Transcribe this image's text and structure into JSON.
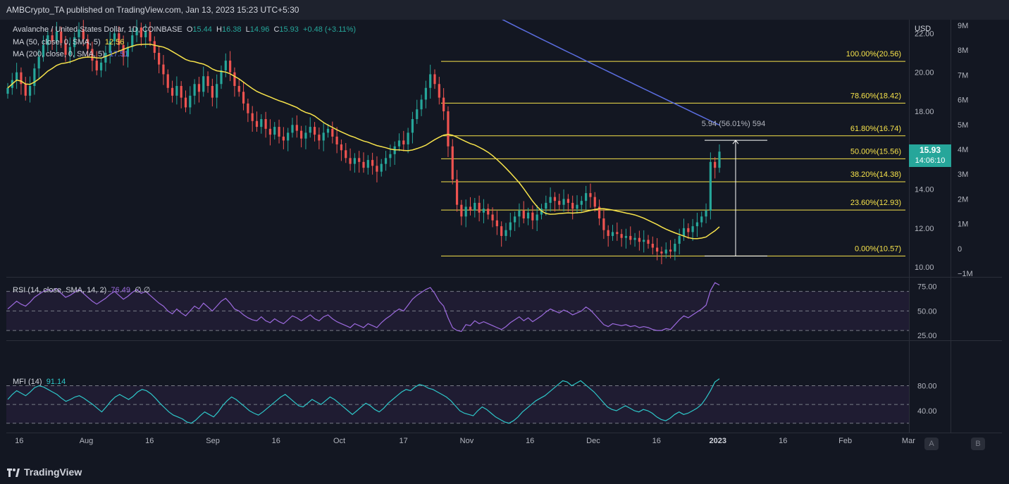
{
  "header": {
    "published_text": "AMBCrypto_TA published on TradingView.com, Jan 13, 2023 15:23 UTC+5:30"
  },
  "legend": {
    "symbol": "Avalanche / United States Dollar, 1D, COINBASE",
    "o_label": "O",
    "o_value": "15.44",
    "h_label": "H",
    "h_value": "16.38",
    "l_label": "L",
    "l_value": "14.96",
    "c_label": "C",
    "c_value": "15.93",
    "change": "+0.48 (+3.11%)",
    "ma50_label": "MA (50, close, 0, SMA, 5)",
    "ma50_value": "12.56",
    "ma200_label": "MA (200, close, 0, SMA, 5)",
    "ma200_value": "17.51",
    "rsi_label": "RSI (14, close, SMA, 14, 2)",
    "rsi_value": "76.49",
    "rsi_extra": "∅ ∅",
    "mfi_label": "MFI (14)",
    "mfi_value": "91.14"
  },
  "price_tag": {
    "price": "15.93",
    "countdown": "14:06:10"
  },
  "currency_label": "USD",
  "measure_label": "5.94 (56.01%) 594",
  "scale_buttons": {
    "a": "A",
    "b": "B"
  },
  "footer": {
    "brand": "TradingView"
  },
  "colors": {
    "up": "#26a69a",
    "down": "#ef5350",
    "ma50": "#f7e34b",
    "ma200": "#5b6ee1",
    "fib": "#f7e34b",
    "rsi": "#9c6ade",
    "mfi": "#2ec7c9",
    "band": "#2a2040"
  },
  "chart_data": {
    "type": "candlestick",
    "title": "Avalanche / United States Dollar, 1D, COINBASE",
    "x_ticks": [
      "16",
      "Aug",
      "16",
      "Sep",
      "16",
      "Oct",
      "17",
      "Nov",
      "16",
      "Dec",
      "16",
      "2023",
      "16",
      "Feb",
      "Mar"
    ],
    "price_ticks": [
      "22.00",
      "20.00",
      "18.00",
      "16.00",
      "14.00",
      "12.00",
      "10.00"
    ],
    "volume_ticks": [
      "9M",
      "8M",
      "7M",
      "6M",
      "5M",
      "4M",
      "3M",
      "2M",
      "1M",
      "0",
      "−1M"
    ],
    "ylim": [
      9.5,
      22.7
    ],
    "fib_levels": [
      {
        "label": "100.00%(20.56)",
        "value": 20.56
      },
      {
        "label": "78.60%(18.42)",
        "value": 18.42
      },
      {
        "label": "61.80%(16.74)",
        "value": 16.74
      },
      {
        "label": "50.00%(15.56)",
        "value": 15.56
      },
      {
        "label": "38.20%(14.38)",
        "value": 14.38
      },
      {
        "label": "23.60%(12.93)",
        "value": 12.93
      },
      {
        "label": "0.00%(10.57)",
        "value": 10.57
      }
    ],
    "closes": [
      19.2,
      19.6,
      20.0,
      19.4,
      18.8,
      19.3,
      20.2,
      20.8,
      21.4,
      21.9,
      21.6,
      22.1,
      21.5,
      20.9,
      21.3,
      21.8,
      22.2,
      21.7,
      21.2,
      20.6,
      20.1,
      20.5,
      21.0,
      21.6,
      22.0,
      21.4,
      20.8,
      21.3,
      21.9,
      22.3,
      21.8,
      22.1,
      21.6,
      21.0,
      20.4,
      19.9,
      19.2,
      18.8,
      19.3,
      18.7,
      18.2,
      18.8,
      19.4,
      19.0,
      19.8,
      19.3,
      18.7,
      19.4,
      20.1,
      20.6,
      20.0,
      19.3,
      19.0,
      18.4,
      17.9,
      17.5,
      17.2,
      17.6,
      17.1,
      16.8,
      17.2,
      16.7,
      16.5,
      16.9,
      17.3,
      17.0,
      16.6,
      16.9,
      17.2,
      16.8,
      16.5,
      16.9,
      17.1,
      16.7,
      16.3,
      16.0,
      15.6,
      15.3,
      15.6,
      15.4,
      15.1,
      15.5,
      15.2,
      14.9,
      15.3,
      15.6,
      15.8,
      16.2,
      16.5,
      16.3,
      16.9,
      17.6,
      18.1,
      18.6,
      19.2,
      19.9,
      19.4,
      18.7,
      18.0,
      16.2,
      14.5,
      13.2,
      12.6,
      13.1,
      12.9,
      13.3,
      12.8,
      13.0,
      12.7,
      12.4,
      12.1,
      11.6,
      11.9,
      12.3,
      12.6,
      12.9,
      12.5,
      12.8,
      12.4,
      12.7,
      13.0,
      13.3,
      13.6,
      13.4,
      13.2,
      13.5,
      13.3,
      13.0,
      13.2,
      13.4,
      13.8,
      13.6,
      13.1,
      12.5,
      11.9,
      11.6,
      11.8,
      11.7,
      11.5,
      11.6,
      11.4,
      11.5,
      11.3,
      11.4,
      11.2,
      11.0,
      10.8,
      10.7,
      10.9,
      10.8,
      11.2,
      11.6,
      12.0,
      11.8,
      12.1,
      12.3,
      12.6,
      12.9,
      15.4,
      15.1,
      15.93
    ],
    "rsi": {
      "ticks": [
        "75.00",
        "50.00",
        "25.00"
      ],
      "ylim": [
        20,
        82
      ],
      "bands": [
        30,
        50,
        70
      ],
      "values": [
        52,
        56,
        60,
        57,
        55,
        59,
        64,
        67,
        70,
        72,
        70,
        73,
        68,
        64,
        66,
        69,
        72,
        68,
        64,
        60,
        57,
        60,
        63,
        67,
        70,
        66,
        62,
        65,
        69,
        72,
        68,
        70,
        66,
        62,
        58,
        55,
        50,
        47,
        52,
        48,
        45,
        50,
        55,
        52,
        58,
        54,
        50,
        55,
        60,
        63,
        58,
        52,
        50,
        46,
        43,
        41,
        40,
        44,
        40,
        38,
        42,
        39,
        37,
        41,
        45,
        43,
        40,
        43,
        46,
        42,
        40,
        44,
        46,
        42,
        39,
        37,
        35,
        33,
        37,
        35,
        33,
        37,
        35,
        33,
        38,
        42,
        45,
        49,
        52,
        50,
        56,
        62,
        66,
        69,
        72,
        74,
        68,
        60,
        55,
        43,
        33,
        30,
        29,
        36,
        35,
        40,
        37,
        39,
        37,
        35,
        33,
        31,
        34,
        38,
        41,
        44,
        40,
        43,
        39,
        42,
        45,
        49,
        52,
        50,
        48,
        51,
        49,
        46,
        48,
        50,
        54,
        51,
        46,
        41,
        36,
        34,
        37,
        36,
        35,
        36,
        34,
        35,
        33,
        34,
        33,
        31,
        30,
        30,
        32,
        31,
        36,
        41,
        45,
        43,
        46,
        49,
        52,
        56,
        71,
        79,
        76.49
      ]
    },
    "mfi": {
      "ticks": [
        "80.00",
        "40.00"
      ],
      "ylim": [
        5,
        102
      ],
      "bands": [
        20,
        50,
        80
      ],
      "values": [
        58,
        66,
        72,
        68,
        64,
        70,
        77,
        80,
        78,
        74,
        70,
        66,
        60,
        55,
        58,
        62,
        64,
        60,
        55,
        50,
        44,
        38,
        46,
        55,
        62,
        66,
        62,
        58,
        63,
        70,
        74,
        72,
        67,
        60,
        52,
        45,
        38,
        33,
        30,
        27,
        22,
        20,
        25,
        32,
        38,
        34,
        30,
        38,
        48,
        56,
        62,
        58,
        52,
        46,
        40,
        36,
        33,
        38,
        44,
        50,
        56,
        62,
        66,
        60,
        54,
        48,
        46,
        52,
        58,
        54,
        50,
        56,
        62,
        58,
        52,
        46,
        40,
        34,
        40,
        46,
        52,
        48,
        42,
        38,
        44,
        52,
        58,
        64,
        70,
        74,
        72,
        78,
        82,
        80,
        76,
        74,
        70,
        66,
        62,
        56,
        48,
        40,
        36,
        34,
        32,
        40,
        46,
        42,
        36,
        30,
        26,
        22,
        20,
        24,
        30,
        38,
        44,
        50,
        56,
        60,
        64,
        70,
        76,
        82,
        88,
        86,
        80,
        84,
        88,
        82,
        76,
        70,
        62,
        54,
        46,
        42,
        40,
        44,
        48,
        44,
        40,
        38,
        42,
        40,
        36,
        30,
        26,
        24,
        28,
        34,
        38,
        34,
        36,
        40,
        44,
        50,
        60,
        72,
        86,
        91.14
      ]
    }
  }
}
